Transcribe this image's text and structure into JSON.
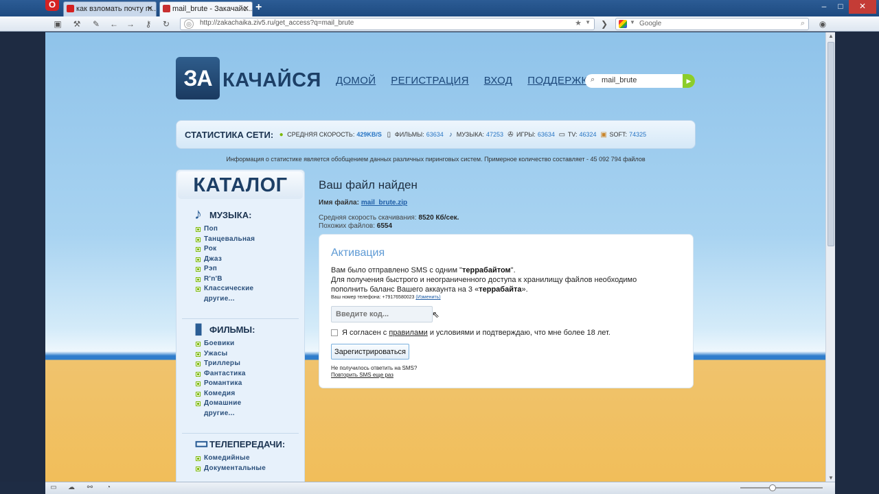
{
  "browser": {
    "tabs": [
      {
        "title": "как взломать почту m...",
        "active": false
      },
      {
        "title": "mail_brute - Закачайс...",
        "active": true
      }
    ],
    "new_tab": "+",
    "url": "http://zakachaika.ziv5.ru/get_access?q=mail_brute",
    "search_engine": "Google",
    "window_controls": {
      "minimize": "–",
      "maximize": "□",
      "close": "✕"
    }
  },
  "site": {
    "logo_badge": "ЗА",
    "logo_text": "КАЧАЙСЯ",
    "nav": [
      "ДОМОЙ",
      "РЕГИСТРАЦИЯ",
      "ВХОД",
      "ПОДДЕРЖКА"
    ],
    "search_value": "mail_brute",
    "stats": {
      "title": "СТАТИСТИКА СЕТИ:",
      "items": [
        {
          "icon": "speed-icon",
          "label": "СРЕДНЯЯ СКОРОСТЬ:",
          "value": "429KB/S"
        },
        {
          "icon": "film-icon",
          "label": "ФИЛЬМЫ:",
          "value": "63634"
        },
        {
          "icon": "music-note-icon",
          "label": "МУЗЫКА:",
          "value": "47253"
        },
        {
          "icon": "gamepad-icon",
          "label": "ИГРЫ:",
          "value": "63634"
        },
        {
          "icon": "tv-icon",
          "label": "TV:",
          "value": "46324"
        },
        {
          "icon": "software-box-icon",
          "label": "SOFT:",
          "value": "74325"
        }
      ]
    },
    "info": "Информация о статистике является обобщением данных различных пиринговых систем. Примерное количество составляет - 45 092 794 файлов"
  },
  "catalog": {
    "title": "КАТАЛОГ",
    "sections": [
      {
        "title": "МУЗЫКА:",
        "icon": "music-note-icon",
        "items": [
          "Поп",
          "Танцевальная",
          "Рок",
          "Джаз",
          "Рэп",
          "R'n'B",
          "Классические"
        ],
        "more": "другие..."
      },
      {
        "title": "ФИЛЬМЫ:",
        "icon": "film-icon",
        "items": [
          "Боевики",
          "Ужасы",
          "Триллеры",
          "Фантастика",
          "Романтика",
          "Комедия",
          "Домашние"
        ],
        "more": "другие..."
      },
      {
        "title": "ТЕЛЕПЕРЕДАЧИ:",
        "icon": "tv-icon",
        "items": [
          "Комедийные",
          "Документальные"
        ],
        "more": ""
      }
    ]
  },
  "file": {
    "heading": "Ваш файл найден",
    "name_label": "Имя файла:",
    "name": "mail_brute.zip",
    "speed_label": "Средняя скорость скачивания:",
    "speed": "8520 Кб/сек.",
    "similar_label": "Похожих файлов:",
    "similar": "6554"
  },
  "activation": {
    "title": "Активация",
    "line1_pre": "Вам было отправлено SMS с одним \"",
    "line1_bold": "террабайтом",
    "line1_post": "\".",
    "line2": "Для получения быстрого и неограниченного доступа к хранилищу файлов необходимо",
    "line3_pre": "пополнить баланс Вашего аккаунта на 3 «",
    "line3_bold": "террабайта",
    "line3_post": "».",
    "phone_label": "Ваш номер телефона: +79176580023",
    "phone_change": "(Изменить)",
    "code_placeholder": "Введите код...",
    "agree_pre": "Я согласен с",
    "agree_link": "правилами",
    "agree_post": "и условиями и подтверждаю, что мне более 18 лет.",
    "agree_checked": false,
    "register_button": "Зарегистрироваться",
    "no_sms": "Не получилось ответить на SMS?",
    "resend": "Повторить SMS еще раз"
  },
  "colors": {
    "accent": "#2674c4",
    "brand": "#1d3f66",
    "ok": "#7ab800"
  }
}
